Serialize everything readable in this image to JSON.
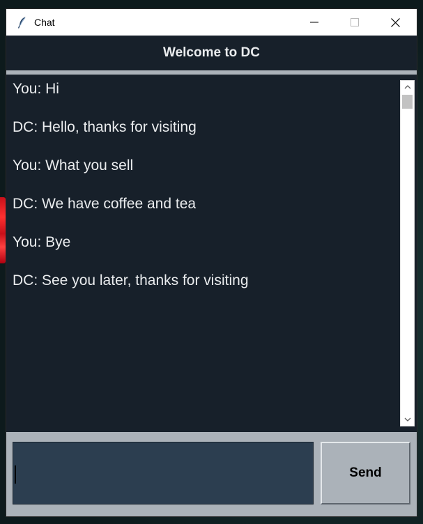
{
  "window": {
    "title": "Chat",
    "icon": "feather-icon",
    "controls": [
      "minimize-icon",
      "maximize-icon",
      "close-icon"
    ]
  },
  "header": {
    "title": "Welcome to DC"
  },
  "chat": {
    "messages": [
      "You: Hi",
      "DC: Hello, thanks for visiting",
      "You: What you sell",
      "DC: We have coffee and tea",
      "You: Bye",
      "DC: See you later, thanks for visiting"
    ]
  },
  "input": {
    "value": "",
    "placeholder": ""
  },
  "send": {
    "label": "Send"
  },
  "colors": {
    "chat_background": "#17202a",
    "text": "#eaecee",
    "frame": "#abb2b9",
    "entry_background": "#2c3e50"
  }
}
